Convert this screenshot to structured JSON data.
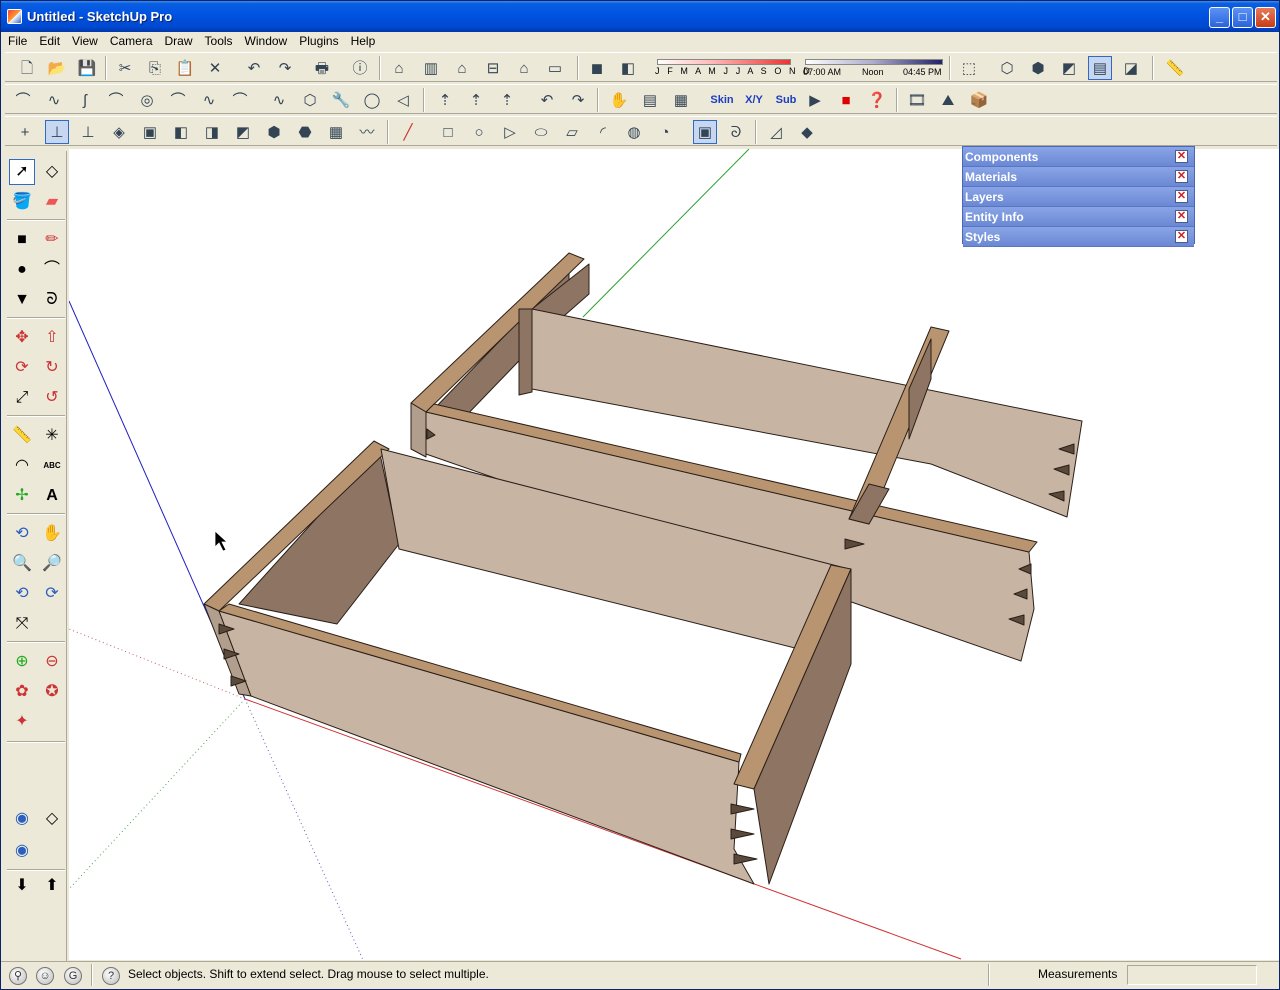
{
  "window": {
    "title": "Untitled - SketchUp Pro",
    "minimize": "_",
    "maximize": "□",
    "close": "✕"
  },
  "menu": [
    "File",
    "Edit",
    "View",
    "Camera",
    "Draw",
    "Tools",
    "Window",
    "Plugins",
    "Help"
  ],
  "shadow_settings": {
    "months": "J F M A M J J A S O N D",
    "time_start": "07:00 AM",
    "time_noon": "Noon",
    "time_end": "04:45 PM"
  },
  "plugin_buttons": {
    "skin": "Skin",
    "xy": "X/Y",
    "sub": "Sub"
  },
  "text_tool_label": "ABC",
  "trays": [
    {
      "label": "Components",
      "close": "✕"
    },
    {
      "label": "Materials",
      "close": "✕"
    },
    {
      "label": "Layers",
      "close": "✕"
    },
    {
      "label": "Entity Info",
      "close": "✕"
    },
    {
      "label": "Styles",
      "close": "✕"
    }
  ],
  "status": {
    "hint": "Select objects. Shift to extend select. Drag mouse to select multiple.",
    "measurements_label": "Measurements",
    "measurements_value": "",
    "icons": [
      "geo-location-icon",
      "credits-icon",
      "google-sign-in-icon",
      "help-icon"
    ]
  },
  "colors": {
    "wood_light": "#c8b4a3",
    "wood_mid": "#b29e8c",
    "wood_dark": "#8e7462",
    "wood_edge": "#b89570",
    "axis_red": "#d03030",
    "axis_green": "#30a030",
    "axis_blue": "#2020c0",
    "tray_blue": "#6f8ed6"
  }
}
